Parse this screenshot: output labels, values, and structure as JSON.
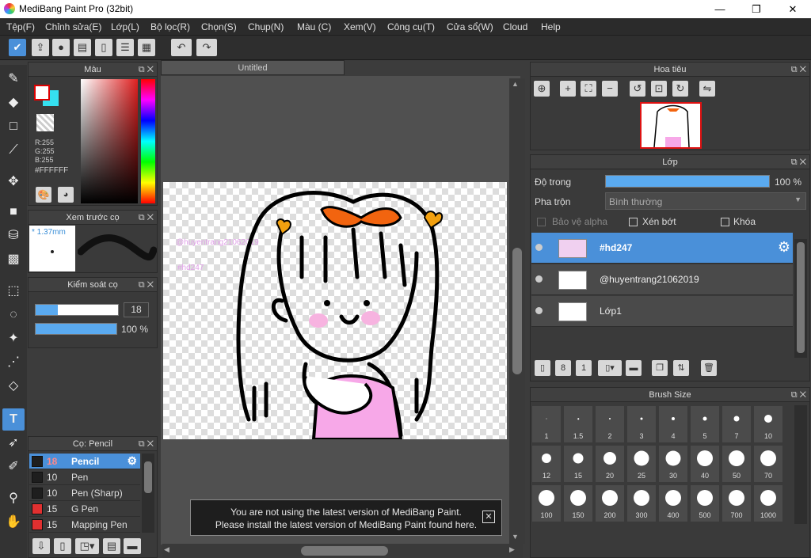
{
  "window": {
    "title": "MediBang Paint Pro (32bit)",
    "minimize": "—",
    "maximize": "❐",
    "close": "✕"
  },
  "menu": [
    "Tệp(F)",
    "Chỉnh sửa(E)",
    "Lớp(L)",
    "Bộ lọc(R)",
    "Chọn(S)",
    "Chụp(N)",
    "Màu (C)",
    "Xem(V)",
    "Công cụ(T)",
    "Cửa sổ(W)",
    "Cloud",
    "Help"
  ],
  "toolbar": {
    "icons": [
      "check-icon",
      "share-icon",
      "comment-icon",
      "speech-icon",
      "document-icon",
      "list-icon",
      "grid-icon"
    ],
    "undo": "↶",
    "redo": "↷"
  },
  "color_panel": {
    "title": "Màu",
    "r": "R:255",
    "g": "G:255",
    "b": "B:255",
    "hex": "#FFFFFF",
    "primary": "#ffffff",
    "secondary": "#35e0f0"
  },
  "brush_preview": {
    "title": "Xem trước cọ",
    "size": "* 1.37mm"
  },
  "brush_control": {
    "title": "Kiểm soát cọ",
    "size": "18",
    "opacity": "100 %",
    "opacity_fraction": 1.0,
    "size_fraction": 0.27
  },
  "brush_list": {
    "title": "Cọ: Pencil",
    "items": [
      {
        "size": "18",
        "name": "Pencil",
        "color": "#1e1e1e",
        "selected": true
      },
      {
        "size": "10",
        "name": "Pen",
        "color": "#1e1e1e",
        "selected": false
      },
      {
        "size": "10",
        "name": "Pen (Sharp)",
        "color": "#1e1e1e",
        "selected": false
      },
      {
        "size": "15",
        "name": "G Pen",
        "color": "#e03030",
        "selected": false
      },
      {
        "size": "15",
        "name": "Mapping Pen",
        "color": "#e03030",
        "selected": false
      }
    ]
  },
  "document": {
    "tab": "Untitled",
    "text1": "@huyentrang21062019",
    "text2": "#hd247"
  },
  "notice": {
    "line1": "You are not using the latest version of MediBang Paint.",
    "line2": "Please install the latest version of MediBang Paint found here."
  },
  "navigator": {
    "title": "Hoa tiêu"
  },
  "layer_panel": {
    "title": "Lớp",
    "opacity_label": "Độ trong",
    "opacity_value": "100 %",
    "opacity_fraction": 1.0,
    "blend_label": "Pha trộn",
    "blend_value": "Bình thường",
    "protect_alpha": "Bảo vệ alpha",
    "clip": "Xén bớt",
    "lock": "Khóa",
    "layers": [
      {
        "name": "#hd247",
        "selected": true
      },
      {
        "name": "@huyentrang21062019",
        "selected": false
      },
      {
        "name": "Lớp1",
        "selected": false
      }
    ]
  },
  "brush_size": {
    "title": "Brush Size",
    "sizes": [
      "1",
      "1.5",
      "2",
      "3",
      "4",
      "5",
      "7",
      "10",
      "12",
      "15",
      "20",
      "25",
      "30",
      "40",
      "50",
      "70",
      "100",
      "150",
      "200",
      "300",
      "400",
      "500",
      "700",
      "1000"
    ]
  }
}
